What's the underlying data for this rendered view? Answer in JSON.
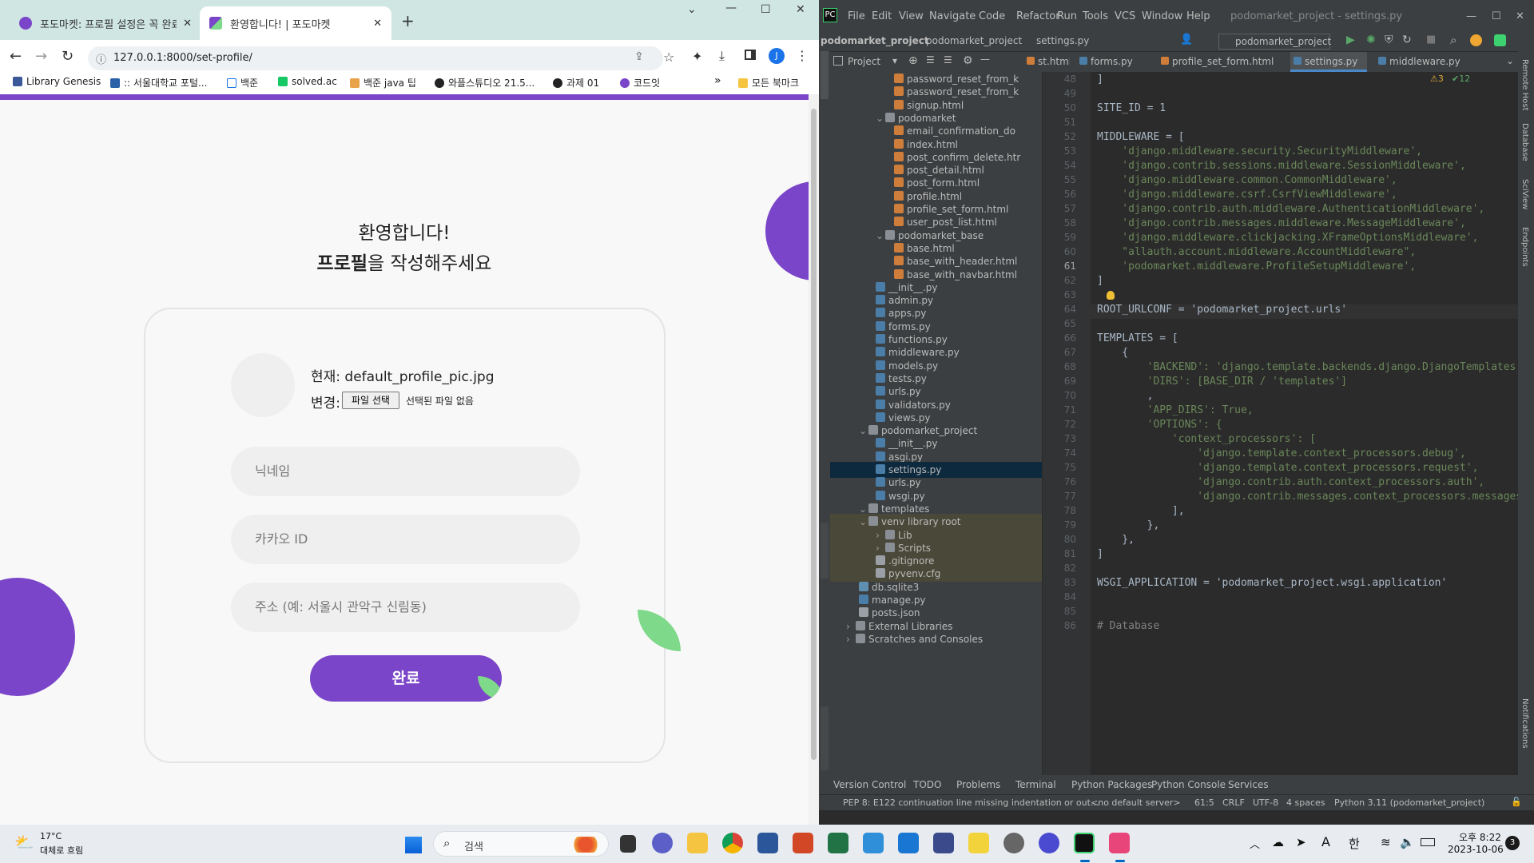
{
  "browser": {
    "tabs": [
      {
        "title": "포도마켓: 프로필 설정은 꼭 완료",
        "active": false
      },
      {
        "title": "환영합니다! | 포도마켓",
        "active": true
      }
    ],
    "url": "127.0.0.1:8000/set-profile/",
    "bookmarks": [
      "Library Genesis",
      ":: 서울대학교 포털...",
      "백준",
      "solved.ac",
      "백준 java 팁",
      "와플스튜디오 21.5...",
      "과제 01",
      "코드잇",
      "모든 북마크"
    ],
    "profile_initial": "J"
  },
  "page": {
    "welcome_line1": "환영합니다!",
    "welcome_bold": "프로필",
    "welcome_rest": "을 작성해주세요",
    "current_label": "현재: default_profile_pic.jpg",
    "change_label": "변경:",
    "file_button": "파일 선택",
    "no_file": "선택된 파일 없음",
    "nickname_placeholder": "닉네임",
    "kakao_placeholder": "카카오 ID",
    "address_placeholder": "주소 (예: 서울시 관악구 신림동)",
    "submit": "완료",
    "accent": "#7a45c8"
  },
  "ide": {
    "menu": [
      "File",
      "Edit",
      "View",
      "Navigate",
      "Code",
      "Refactor",
      "Run",
      "Tools",
      "VCS",
      "Window",
      "Help"
    ],
    "window_title": "podomarket_project - settings.py",
    "breadcrumbs": [
      "podomarket_project",
      "podomarket_project",
      "settings.py"
    ],
    "run_config": "podomarket_project",
    "project_label": "Project",
    "editor_tabs": [
      "st.html",
      "forms.py",
      "profile_set_form.html",
      "settings.py",
      "middleware.py"
    ],
    "inspection": {
      "warnings": "3",
      "ok": "12"
    },
    "tree": [
      {
        "name": "password_reset_from_k",
        "type": "html",
        "indent": 3
      },
      {
        "name": "password_reset_from_k",
        "type": "html",
        "indent": 3
      },
      {
        "name": "signup.html",
        "type": "html",
        "indent": 3
      },
      {
        "name": "podomarket",
        "type": "dir",
        "indent": 2
      },
      {
        "name": "email_confirmation_do",
        "type": "html",
        "indent": 3
      },
      {
        "name": "index.html",
        "type": "html",
        "indent": 3
      },
      {
        "name": "post_confirm_delete.htr",
        "type": "html",
        "indent": 3
      },
      {
        "name": "post_detail.html",
        "type": "html",
        "indent": 3
      },
      {
        "name": "post_form.html",
        "type": "html",
        "indent": 3
      },
      {
        "name": "profile.html",
        "type": "html",
        "indent": 3
      },
      {
        "name": "profile_set_form.html",
        "type": "html",
        "indent": 3
      },
      {
        "name": "user_post_list.html",
        "type": "html",
        "indent": 3
      },
      {
        "name": "podomarket_base",
        "type": "dir",
        "indent": 2
      },
      {
        "name": "base.html",
        "type": "html",
        "indent": 3
      },
      {
        "name": "base_with_header.html",
        "type": "html",
        "indent": 3
      },
      {
        "name": "base_with_navbar.html",
        "type": "html",
        "indent": 3
      },
      {
        "name": "__init__.py",
        "type": "py",
        "indent": 2
      },
      {
        "name": "admin.py",
        "type": "py",
        "indent": 2
      },
      {
        "name": "apps.py",
        "type": "py",
        "indent": 2
      },
      {
        "name": "forms.py",
        "type": "py",
        "indent": 2
      },
      {
        "name": "functions.py",
        "type": "py",
        "indent": 2
      },
      {
        "name": "middleware.py",
        "type": "py",
        "indent": 2
      },
      {
        "name": "models.py",
        "type": "py",
        "indent": 2
      },
      {
        "name": "tests.py",
        "type": "py",
        "indent": 2
      },
      {
        "name": "urls.py",
        "type": "py",
        "indent": 2
      },
      {
        "name": "validators.py",
        "type": "py",
        "indent": 2
      },
      {
        "name": "views.py",
        "type": "py",
        "indent": 2
      },
      {
        "name": "podomarket_project",
        "type": "dir",
        "indent": 1
      },
      {
        "name": "__init__.py",
        "type": "py",
        "indent": 2
      },
      {
        "name": "asgi.py",
        "type": "py",
        "indent": 2
      },
      {
        "name": "settings.py",
        "type": "py",
        "indent": 2
      },
      {
        "name": "urls.py",
        "type": "py",
        "indent": 2
      },
      {
        "name": "wsgi.py",
        "type": "py",
        "indent": 2
      },
      {
        "name": "templates",
        "type": "dir",
        "indent": 1
      },
      {
        "name": "venv  library root",
        "type": "dir",
        "indent": 1
      },
      {
        "name": "Lib",
        "type": "dir",
        "indent": 2
      },
      {
        "name": "Scripts",
        "type": "dir",
        "indent": 2
      },
      {
        "name": ".gitignore",
        "type": "cfg",
        "indent": 2
      },
      {
        "name": "pyvenv.cfg",
        "type": "cfg",
        "indent": 2
      },
      {
        "name": "db.sqlite3",
        "type": "db",
        "indent": 1
      },
      {
        "name": "manage.py",
        "type": "py",
        "indent": 1
      },
      {
        "name": "posts.json",
        "type": "cfg",
        "indent": 1
      },
      {
        "name": "External Libraries",
        "type": "dir",
        "indent": 0
      },
      {
        "name": "Scratches and Consoles",
        "type": "dir",
        "indent": 0
      }
    ],
    "line_numbers": [
      "48",
      "49",
      "50",
      "51",
      "52",
      "53",
      "54",
      "55",
      "56",
      "57",
      "58",
      "59",
      "60",
      "61",
      "62",
      "63",
      "64",
      "65",
      "66",
      "67",
      "68",
      "69",
      "70",
      "71",
      "72",
      "73",
      "74",
      "75",
      "76",
      "77",
      "78",
      "79",
      "80",
      "81",
      "82",
      "83",
      "84",
      "85",
      "86"
    ],
    "code": [
      "]",
      "",
      "SITE_ID = 1",
      "",
      "MIDDLEWARE = [",
      "    'django.middleware.security.SecurityMiddleware',",
      "    'django.contrib.sessions.middleware.SessionMiddleware',",
      "    'django.middleware.common.CommonMiddleware',",
      "    'django.middleware.csrf.CsrfViewMiddleware',",
      "    'django.contrib.auth.middleware.AuthenticationMiddleware',",
      "    'django.contrib.messages.middleware.MessageMiddleware',",
      "    'django.middleware.clickjacking.XFrameOptionsMiddleware',",
      "    \"allauth.account.middleware.AccountMiddleware\",",
      "    'podomarket.middleware.ProfileSetupMiddleware',",
      "]",
      "",
      "ROOT_URLCONF = 'podomarket_project.urls'",
      "",
      "TEMPLATES = [",
      "    {",
      "        'BACKEND': 'django.template.backends.django.DjangoTemplates',",
      "        'DIRS': [BASE_DIR / 'templates']",
      "        ,",
      "        'APP_DIRS': True,",
      "        'OPTIONS': {",
      "            'context_processors': [",
      "                'django.template.context_processors.debug',",
      "                'django.template.context_processors.request',",
      "                'django.contrib.auth.context_processors.auth',",
      "                'django.contrib.messages.context_processors.messages',",
      "            ],",
      "        },",
      "    },",
      "]",
      "",
      "WSGI_APPLICATION = 'podomarket_project.wsgi.application'",
      "",
      "",
      "# Database"
    ],
    "bottom_tabs": [
      "Version Control",
      "TODO",
      "Problems",
      "Terminal",
      "Python Packages",
      "Python Console",
      "Services"
    ],
    "status": {
      "message": "PEP 8: E122 continuation line missing indentation or out...",
      "server": "<no default server>",
      "position": "61:5",
      "line_sep": "CRLF",
      "encoding": "UTF-8",
      "indent": "4 spaces",
      "interpreter": "Python 3.11 (podomarket_project)"
    },
    "side_labels": {
      "remote_host": "Remote Host",
      "database": "Database",
      "sciview": "SciView",
      "endpoints": "Endpoints",
      "notifications": "Notifications"
    }
  },
  "taskbar": {
    "weather_temp": "17°C",
    "weather_desc": "대체로 흐림",
    "search": "검색",
    "time": "오후 8:22",
    "date": "2023-10-06",
    "ime": "한",
    "notif_count": "3"
  }
}
